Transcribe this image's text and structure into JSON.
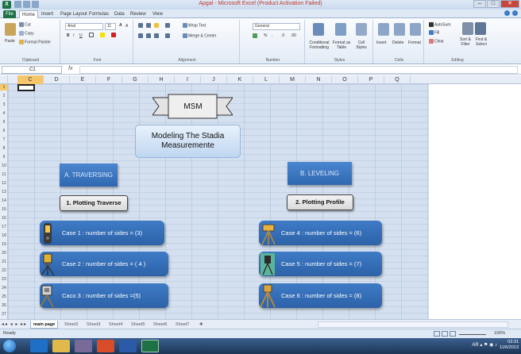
{
  "window": {
    "title": "Apgal - Microsoft Excel (Product Activation Failed)",
    "app_icon": "excel-icon"
  },
  "ribbon_tabs": [
    "File",
    "Home",
    "Insert",
    "Page Layout",
    "Formulas",
    "Data",
    "Review",
    "View"
  ],
  "ribbon": {
    "clipboard": {
      "cut": "Cut",
      "copy": "Copy",
      "paste": "Paste",
      "format_painter": "Format Painter",
      "label": "Clipboard"
    },
    "font": {
      "name": "Arial",
      "size": "11",
      "label": "Font"
    },
    "alignment": {
      "wrap_text": "Wrap Text",
      "merge_center": "Merge & Center",
      "label": "Alignment"
    },
    "number": {
      "format": "General",
      "label": "Number"
    },
    "styles": {
      "conditional": "Conditional Formatting",
      "format_table": "Format as Table",
      "cell_styles": "Cell Styles",
      "label": "Styles"
    },
    "cells": {
      "insert": "Insert",
      "delete": "Delete",
      "format": "Format",
      "label": "Cells"
    },
    "editing": {
      "autosum": "AutoSum",
      "fill": "Fill",
      "clear": "Clear",
      "sort_filter": "Sort & Filter",
      "find_select": "Find & Select",
      "label": "Editing"
    }
  },
  "formula_bar": {
    "name_box": "C1",
    "fx": "fx",
    "value": ""
  },
  "columns": [
    "C",
    "D",
    "E",
    "F",
    "G",
    "H",
    "I",
    "J",
    "K",
    "L",
    "M",
    "N",
    "O",
    "P",
    "Q"
  ],
  "rows": [
    "1",
    "2",
    "3",
    "4",
    "5",
    "6",
    "7",
    "8",
    "9",
    "10",
    "11",
    "12",
    "13",
    "14",
    "15",
    "16",
    "17",
    "18",
    "19",
    "20",
    "21",
    "22",
    "23",
    "24",
    "25",
    "26",
    "27"
  ],
  "shapes": {
    "banner": "MSM",
    "title_line1": "Modeling The Stadia",
    "title_line2": "Measuremente",
    "section_a": "A. TRAVERSING",
    "section_b": "B. LEVELING",
    "plot_traverse": "1. Plotting Traverse",
    "plot_profile": "2. Plotting Profile",
    "cases_left": [
      "Case 1 : number of sides = (3)",
      "Case 2 : number of sides  = ( 4 )",
      "Caco  3 : number of sides =(5)"
    ],
    "cases_right": [
      "Case 4 : number of sides = (6)",
      "Case 5 : number of sides = (7)",
      "Case 6 : number of sides = (8)"
    ]
  },
  "sheet_tabs": [
    "main page",
    "Sheet2",
    "Sheet3",
    "Sheet4",
    "Sheet5",
    "Sheet6",
    "Sheet7"
  ],
  "status": {
    "ready": "Ready",
    "zoom": "100%"
  },
  "taskbar": {
    "time": "03:31",
    "date": "11/6/2013",
    "lang": "AR"
  },
  "colors": {
    "case_fill": "#2f68b1",
    "section_fill": "#3a75c0",
    "sheet_bg": "#d4e0ef",
    "excel_green": "#1e7145"
  }
}
